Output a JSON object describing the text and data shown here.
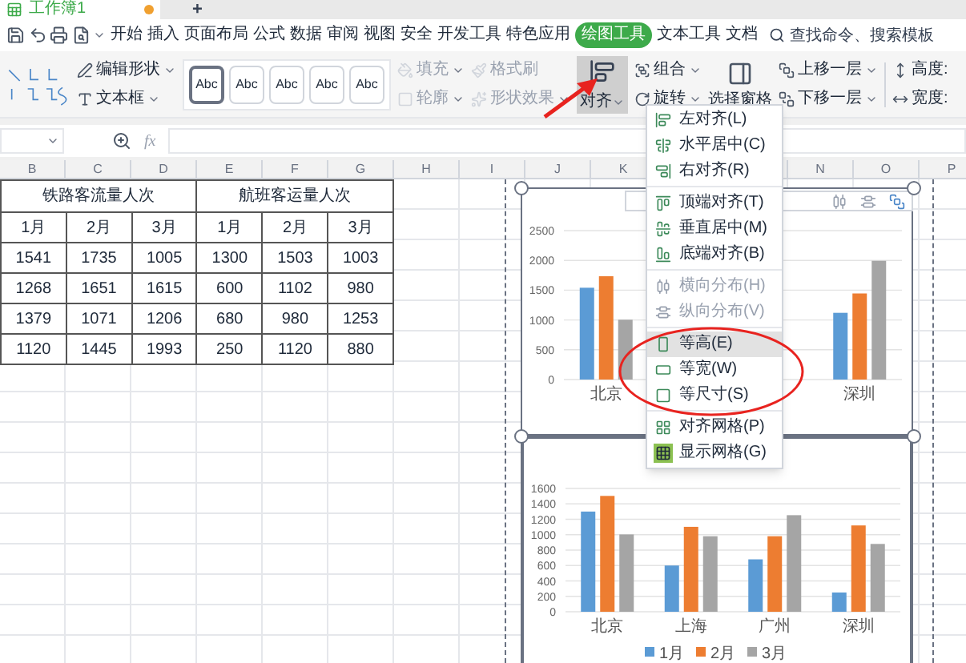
{
  "document_tabs": [
    {
      "label": "工作簿1",
      "selected": true,
      "unsaved": true
    }
  ],
  "new_tab_button": "+",
  "menu_tabs": [
    {
      "label": "开始",
      "selected": false
    },
    {
      "label": "插入",
      "selected": false
    },
    {
      "label": "页面布局",
      "selected": false
    },
    {
      "label": "公式",
      "selected": false
    },
    {
      "label": "数据",
      "selected": false
    },
    {
      "label": "审阅",
      "selected": false
    },
    {
      "label": "视图",
      "selected": false
    },
    {
      "label": "安全",
      "selected": false
    },
    {
      "label": "开发工具",
      "selected": false
    },
    {
      "label": "特色应用",
      "selected": false
    },
    {
      "label": "绘图工具",
      "selected": true
    },
    {
      "label": "文本工具",
      "selected": false
    },
    {
      "label": "文档",
      "selected": false
    }
  ],
  "search": {
    "placeholder": "查找命令、搜索模板"
  },
  "ribbon": {
    "edit_shape": "编辑形状",
    "text_box": "文本框",
    "style_presets": [
      {
        "label": "Abc",
        "selected": true
      },
      {
        "label": "Abc",
        "selected": false
      },
      {
        "label": "Abc",
        "selected": false
      },
      {
        "label": "Abc",
        "selected": false
      },
      {
        "label": "Abc",
        "selected": false
      }
    ],
    "format_tools": [
      {
        "label": "填充",
        "disabled": true
      },
      {
        "label": "轮廓",
        "disabled": true
      },
      {
        "label": "格式刷",
        "disabled": true
      },
      {
        "label": "形状效果",
        "disabled": true
      }
    ],
    "align": {
      "label": "对齐",
      "open": true
    },
    "arrange": [
      {
        "label": "组合"
      },
      {
        "label": "旋转"
      }
    ],
    "selection_pane": "选择窗格",
    "layers": [
      {
        "label": "上移一层"
      },
      {
        "label": "下移一层"
      }
    ],
    "size": [
      {
        "label": "高度:"
      },
      {
        "label": "宽度:"
      }
    ]
  },
  "formula_bar": {
    "fx_label": "fx"
  },
  "column_headers": [
    "B",
    "C",
    "D",
    "E",
    "F",
    "G",
    "H",
    "I",
    "J",
    "K",
    "N",
    "O",
    "P"
  ],
  "table": {
    "group_headers": [
      "铁路客流量人次",
      "航班客运量人次"
    ],
    "months": [
      "1月",
      "2月",
      "3月",
      "1月",
      "2月",
      "3月"
    ],
    "rows": [
      [
        "1541",
        "1735",
        "1005",
        "1300",
        "1503",
        "1003"
      ],
      [
        "1268",
        "1651",
        "1615",
        "600",
        "1102",
        "980"
      ],
      [
        "1379",
        "1071",
        "1206",
        "680",
        "980",
        "1253"
      ],
      [
        "1120",
        "1445",
        "1993",
        "250",
        "1120",
        "880"
      ]
    ]
  },
  "charts": [
    {
      "chart_data": {
        "type": "bar",
        "categories": [
          "北京",
          "深圳"
        ],
        "ylim": [
          0,
          2500
        ],
        "yticks": [
          0,
          500,
          1000,
          1500,
          2000,
          2500
        ],
        "grid": true,
        "series": [
          {
            "color": "#5b9bd5",
            "values": [
              1541,
              1120
            ]
          },
          {
            "color": "#ed7d31",
            "values": [
              1735,
              1445
            ]
          },
          {
            "color": "#a5a5a5",
            "values": [
              1005,
              1993
            ]
          }
        ]
      }
    },
    {
      "chart_data": {
        "type": "bar",
        "categories": [
          "北京",
          "上海",
          "广州",
          "深圳"
        ],
        "ylim": [
          0,
          1600
        ],
        "yticks": [
          0,
          200,
          400,
          600,
          800,
          1000,
          1200,
          1400,
          1600
        ],
        "grid": true,
        "legend": true,
        "series": [
          {
            "name": "1月",
            "color": "#5b9bd5",
            "values": [
              1300,
              600,
              680,
              250
            ]
          },
          {
            "name": "2月",
            "color": "#ed7d31",
            "values": [
              1503,
              1102,
              980,
              1120
            ]
          },
          {
            "name": "3月",
            "color": "#a5a5a5",
            "values": [
              1003,
              980,
              1253,
              880
            ]
          }
        ]
      }
    }
  ],
  "align_menu": {
    "groups": [
      [
        {
          "label": "左对齐(L)",
          "disabled": false,
          "highlighted": false,
          "checked": false
        },
        {
          "label": "水平居中(C)",
          "disabled": false,
          "highlighted": false,
          "checked": false
        },
        {
          "label": "右对齐(R)",
          "disabled": false,
          "highlighted": false,
          "checked": false
        }
      ],
      [
        {
          "label": "顶端对齐(T)",
          "disabled": false,
          "highlighted": false,
          "checked": false
        },
        {
          "label": "垂直居中(M)",
          "disabled": false,
          "highlighted": false,
          "checked": false
        },
        {
          "label": "底端对齐(B)",
          "disabled": false,
          "highlighted": false,
          "checked": false
        }
      ],
      [
        {
          "label": "横向分布(H)",
          "disabled": true,
          "highlighted": false,
          "checked": false
        },
        {
          "label": "纵向分布(V)",
          "disabled": true,
          "highlighted": false,
          "checked": false
        }
      ],
      [
        {
          "label": "等高(E)",
          "disabled": false,
          "highlighted": true,
          "checked": false
        },
        {
          "label": "等宽(W)",
          "disabled": false,
          "highlighted": false,
          "checked": false
        },
        {
          "label": "等尺寸(S)",
          "disabled": false,
          "highlighted": false,
          "checked": false
        }
      ],
      [
        {
          "label": "对齐网格(P)",
          "disabled": false,
          "highlighted": false,
          "checked": false
        },
        {
          "label": "显示网格(G)",
          "disabled": false,
          "highlighted": false,
          "checked": true
        }
      ]
    ]
  }
}
